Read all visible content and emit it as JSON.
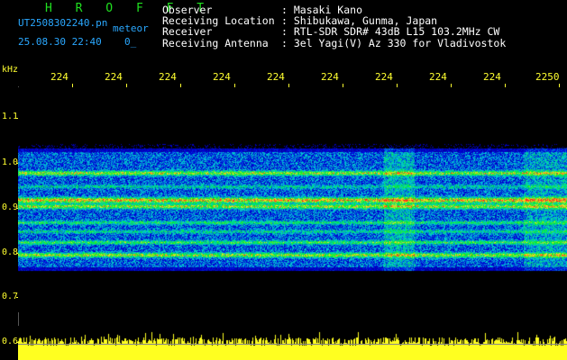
{
  "header": {
    "brand": "H R O F F T",
    "filename": "UT2508302240.pn",
    "suffix": "meteor",
    "datetime": "25.08.30 22:40",
    "counter": "0_"
  },
  "meta": [
    {
      "key": "Observer",
      "value": ": Masaki Kano"
    },
    {
      "key": "Receiving Location",
      "value": ": Shibukawa, Gunma, Japan"
    },
    {
      "key": "Receiver",
      "value": ": RTL-SDR SDR# 43dB L15 103.2MHz CW"
    },
    {
      "key": "Receiving Antenna",
      "value": ": 3el Yagi(V) Az 330 for Vladivostok"
    }
  ],
  "axis": {
    "y_unit": "kHz",
    "y_ticks": [
      "1.1",
      "1.0",
      "0.9",
      "0.8",
      "0.7",
      "0.6"
    ],
    "x_ticks": [
      "224",
      "224",
      "224",
      "224",
      "224",
      "224",
      "224",
      "224",
      "224",
      "2250"
    ]
  },
  "colors": {
    "axis": "#ffff30",
    "brand": "#20e020",
    "info": "#2aa8ff",
    "text": "#ffffff"
  }
}
